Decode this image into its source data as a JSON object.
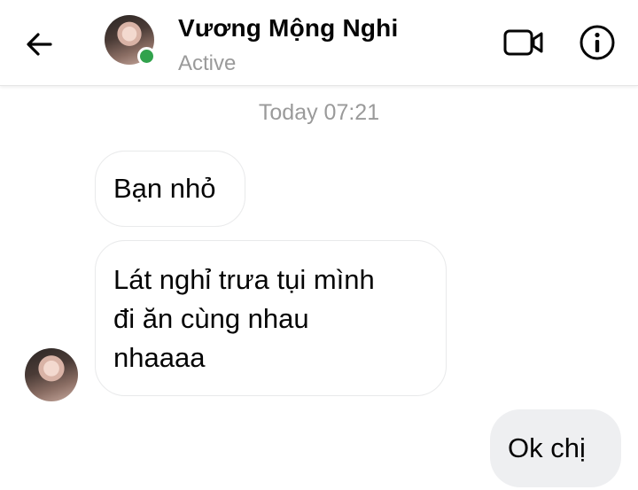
{
  "header": {
    "contact_name": "Vương Mộng Nghi",
    "status": "Active",
    "online_color": "#31a24c",
    "icons": [
      "back-arrow-icon",
      "video-call-icon",
      "info-icon"
    ]
  },
  "conversation": {
    "timestamp": "Today 07:21",
    "incoming": [
      {
        "text": "Bạn nhỏ"
      },
      {
        "text_lines": [
          "Lát nghỉ trưa tụi mình",
          "đi ăn cùng nhau",
          "nhaaaa"
        ]
      }
    ],
    "outgoing": [
      {
        "text": "Ok chị"
      }
    ]
  }
}
